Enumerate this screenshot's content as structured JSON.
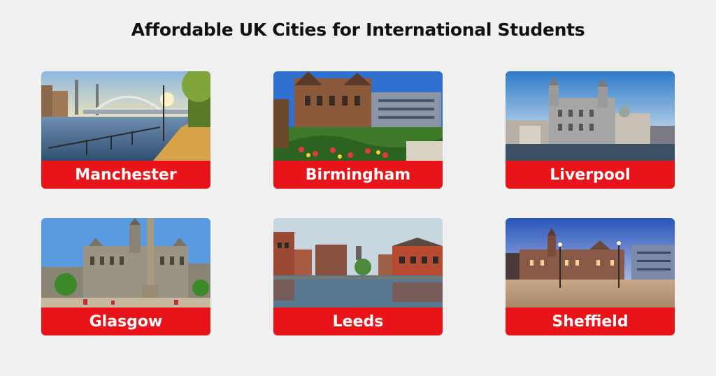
{
  "title": "Affordable UK Cities for International Students",
  "accent_color": "#e8141a",
  "cities": [
    {
      "name": "Manchester"
    },
    {
      "name": "Birmingham"
    },
    {
      "name": "Liverpool"
    },
    {
      "name": "Glasgow"
    },
    {
      "name": "Leeds"
    },
    {
      "name": "Sheffield"
    }
  ]
}
